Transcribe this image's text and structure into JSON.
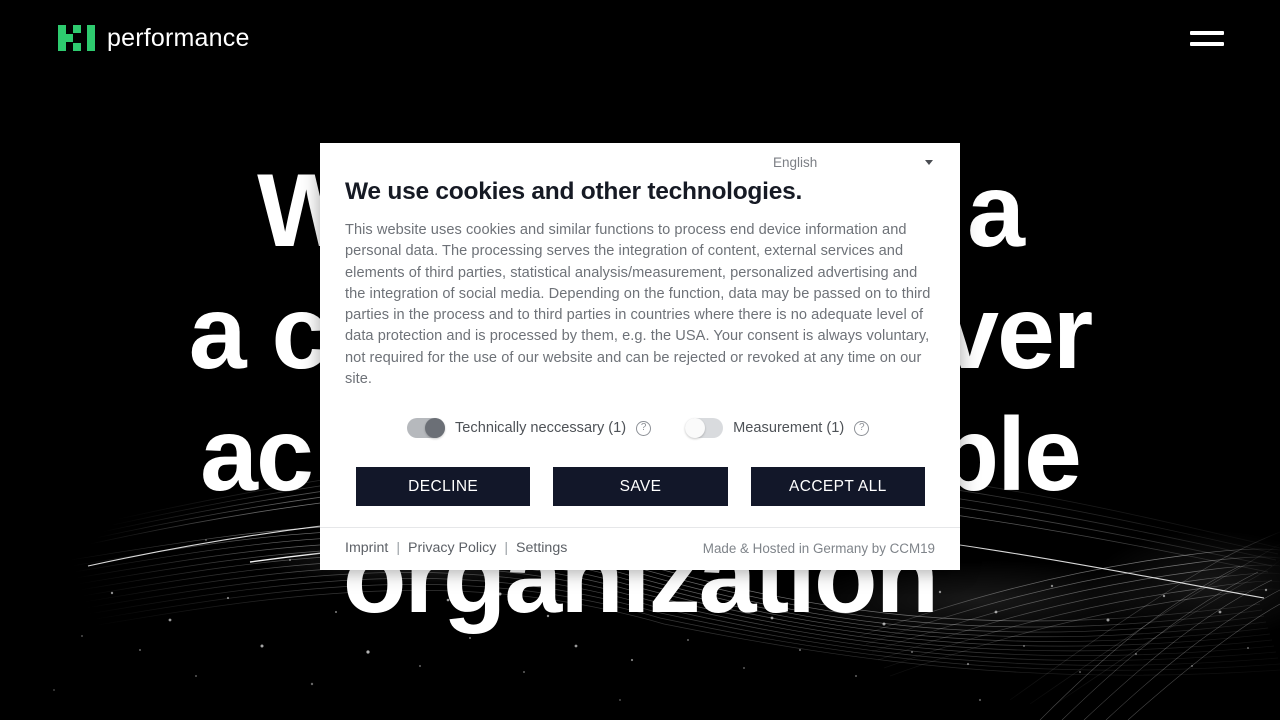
{
  "topbar": {
    "logo_mark_name": "ki-performance-logo-mark",
    "logo_text": "performance",
    "logo_color": "#2ecb6f",
    "menu_icon_name": "hamburger-menu-icon"
  },
  "hero": {
    "lines": [
      "W    ...    a",
      "a c           ver",
      "ac            ble",
      "organization"
    ],
    "line1": "W",
    "line1b": "a",
    "line2a": "a c",
    "line2b": "ver",
    "line3a": "ac",
    "line3b": "ble",
    "line4": "organization"
  },
  "dialog": {
    "language": {
      "selected": "English",
      "caret_icon_name": "chevron-down-icon"
    },
    "title": "We use cookies and other technologies.",
    "body": "This website uses cookies and similar functions to process end device information and personal data. The processing serves the integration of content, external services and elements of third parties, statistical analysis/measurement, personalized advertising and the integration of social media. Depending on the function, data may be passed on to third parties in the process and to third parties in countries where there is no adequate level of data protection and is processed by them, e.g. the USA. Your consent is always voluntary, not required for the use of our website and can be rejected or revoked at any time on our site.",
    "toggles": [
      {
        "label": "Technically neccessary (1)",
        "state": "on",
        "help_icon": "?"
      },
      {
        "label": "Measurement (1)",
        "state": "off",
        "help_icon": "?"
      }
    ],
    "buttons": [
      {
        "label": "DECLINE",
        "name": "decline-button"
      },
      {
        "label": "SAVE",
        "name": "save-button"
      },
      {
        "label": "ACCEPT ALL",
        "name": "accept-all-button"
      }
    ],
    "footer": {
      "links": [
        "Imprint",
        "Privacy Policy",
        "Settings"
      ],
      "separator": "|",
      "credit": "Made & Hosted in Germany by CCM19"
    },
    "colors": {
      "button_bg": "#121729",
      "title_color": "#161a24",
      "body_color": "#6e7278",
      "panel_bg": "#ffffff"
    }
  }
}
